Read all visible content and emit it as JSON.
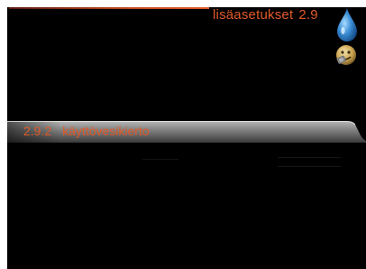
{
  "header": {
    "title": "lisäasetukset",
    "number": "2.9"
  },
  "icons": {
    "top": "water-drop-icon",
    "second": "smiley-face-icon"
  },
  "menu": {
    "items": [
      {
        "code": "2.9.2",
        "label": "käyttövesikierto",
        "selected": true
      }
    ]
  },
  "colors": {
    "accent": "#e05a28",
    "background": "#000000"
  }
}
